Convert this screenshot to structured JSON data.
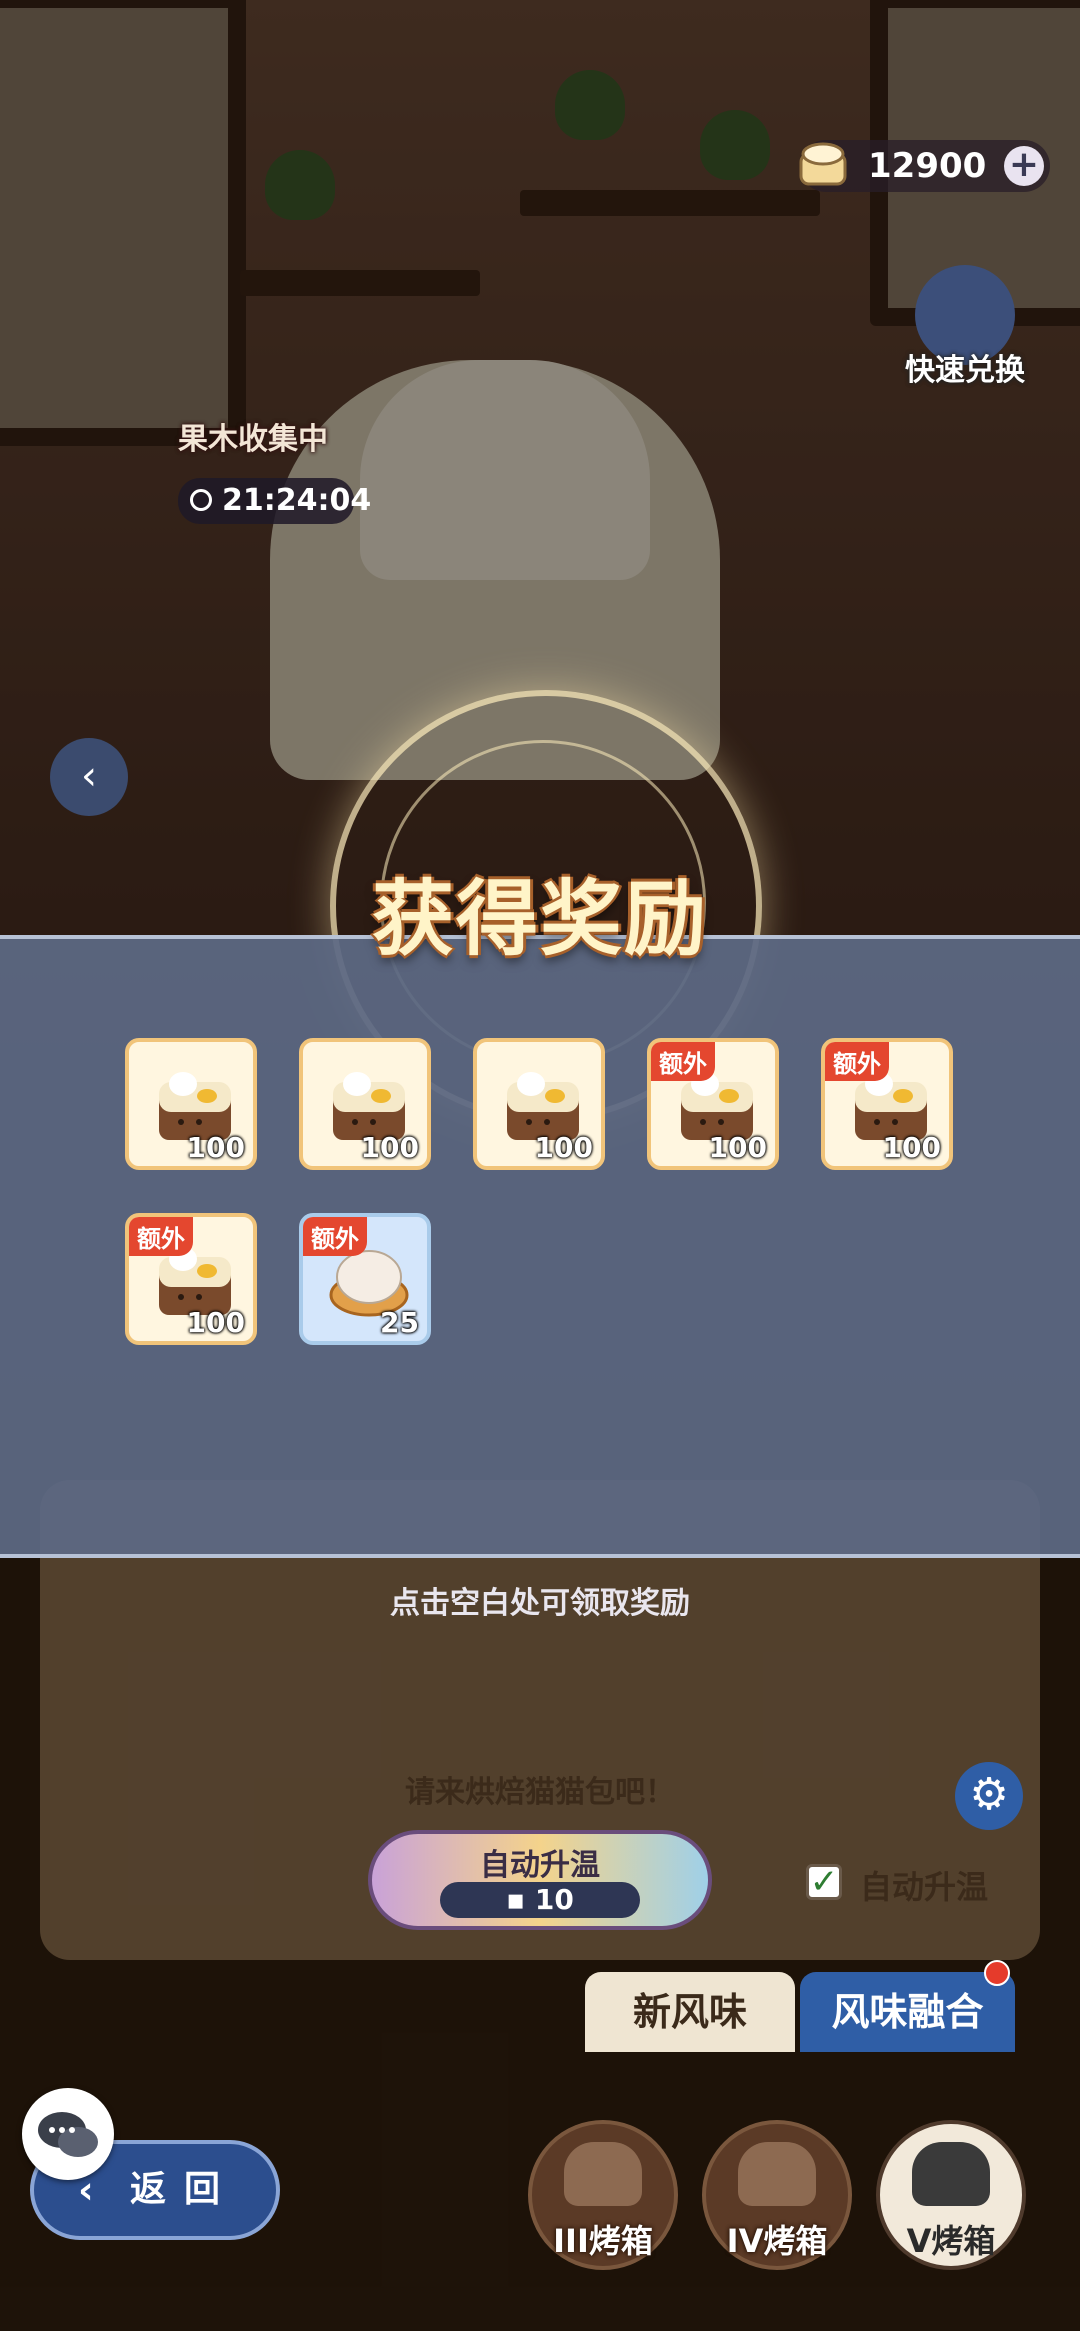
{
  "hud": {
    "currency_value": "12900",
    "plus_label": "+",
    "quick_exchange_label": "快速兑换",
    "collect_label": "果木收集中",
    "timer": "21:24:04"
  },
  "reward_popup": {
    "title": "获得奖励",
    "items": [
      {
        "type": "bread",
        "count": "100",
        "tag": ""
      },
      {
        "type": "bread",
        "count": "100",
        "tag": ""
      },
      {
        "type": "bread",
        "count": "100",
        "tag": ""
      },
      {
        "type": "bread",
        "count": "100",
        "tag": "额外"
      },
      {
        "type": "bread",
        "count": "100",
        "tag": "额外"
      },
      {
        "type": "bread",
        "count": "100",
        "tag": "额外"
      },
      {
        "type": "dough-bowl",
        "count": "25",
        "tag": "额外"
      }
    ],
    "tap_hint": "点击空白处可领取奖励"
  },
  "bake_panel": {
    "title": "请来烘焙猫猫包吧！",
    "auto_button_label": "自动升温",
    "auto_button_cost": "10",
    "auto_checkbox_label": "自动升温",
    "auto_checkbox_checked": true
  },
  "tabs": {
    "new_flavor": "新风味",
    "flavor_fusion": "风味融合"
  },
  "nav": {
    "back_label": "返回",
    "ovens": [
      "III烤箱",
      "IV烤箱",
      "V烤箱"
    ]
  },
  "colors": {
    "banner": "#5c6984",
    "title_text": "#fff4c8",
    "extra_tag": "#e4472f",
    "tab_active": "#2f5ea6"
  }
}
